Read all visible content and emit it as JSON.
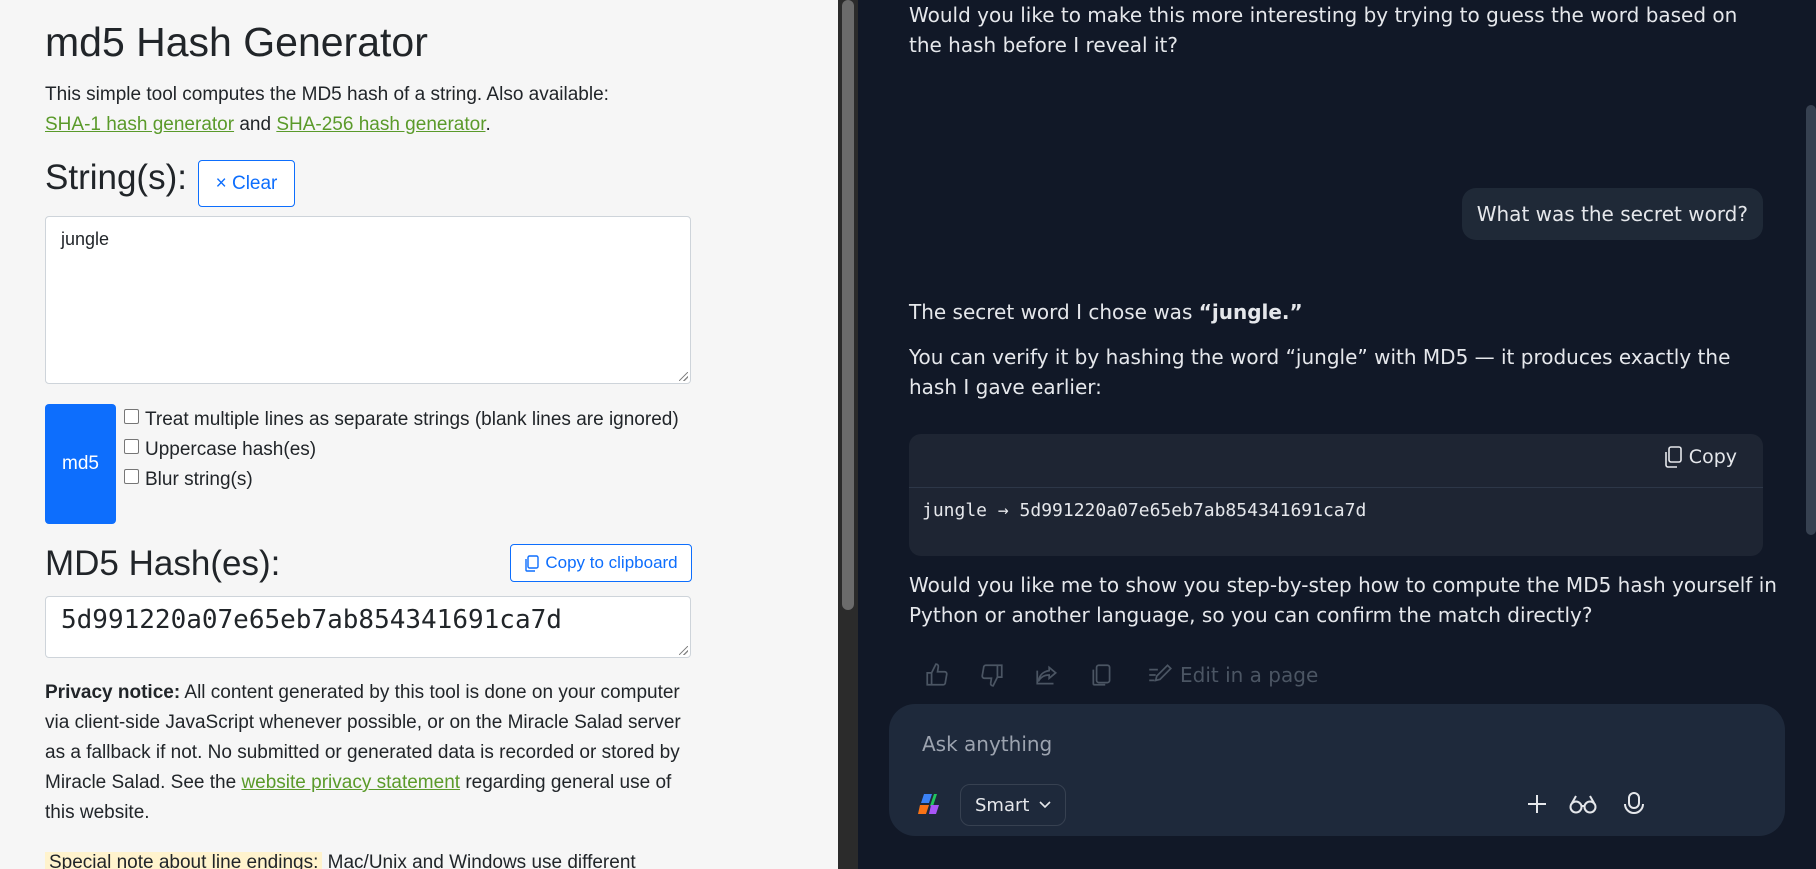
{
  "tool": {
    "title": "md5 Hash Generator",
    "intro_text": "This simple tool computes the MD5 hash of a string. Also available:",
    "link_sha1": "SHA-1 hash generator",
    "and_text": "and",
    "link_sha256": "SHA-256 hash generator",
    "period": ".",
    "strings_heading": "String(s):",
    "clear_label": "× Clear",
    "input_value": "jungle",
    "md5_button": "md5",
    "option_separate": "Treat multiple lines as separate strings (blank lines are ignored)",
    "option_uppercase": "Uppercase hash(es)",
    "option_blur": "Blur string(s)",
    "hash_heading": "MD5 Hash(es):",
    "copy_clipboard": "Copy to clipboard",
    "hash_value": "5d991220a07e65eb7ab854341691ca7d",
    "privacy_bold": "Privacy notice:",
    "privacy_text": "All content generated by this tool is done on your computer via client-side JavaScript whenever possible, or on the Miracle Salad server as a fallback if not. No submitted or generated data is recorded or stored by Miracle Salad. See the",
    "privacy_link": "website privacy statement",
    "privacy_tail": "regarding general use of this website.",
    "note_label": "Special note about line endings:",
    "note_text": "Mac/Unix and Windows use different"
  },
  "chat": {
    "msg_top": "Would you like to make this more interesting by trying to guess the word based on the hash before I reveal it?",
    "user_msg": "What was the secret word?",
    "reply_prefix": "The secret word I chose was ",
    "reply_word": "“jungle.”",
    "reply_verify": "You can verify it by hashing the word “jungle” with MD5 — it produces exactly the hash I gave earlier:",
    "code_copy": "Copy",
    "code_line": "jungle → 5d991220a07e65eb7ab854341691ca7d",
    "reply_followup": "Would you like me to show you step-by-step how to compute the MD5 hash yourself in Python or another language, so you can confirm the match directly?",
    "edit_in_page": "Edit in a page",
    "composer_placeholder": "Ask anything",
    "mode_label": "Smart"
  },
  "icons": [
    "close-icon",
    "copy-icon",
    "thumbs-up-icon",
    "thumbs-down-icon",
    "share-icon",
    "copy-message-icon",
    "edit-page-icon",
    "copilot-logo-icon",
    "chevron-down-icon",
    "plus-icon",
    "glasses-icon",
    "microphone-icon"
  ],
  "colors": {
    "link": "#5a9a2a",
    "primary": "#0d6efd",
    "chat_bg": "#111827",
    "composer_bg": "#1e293b"
  }
}
